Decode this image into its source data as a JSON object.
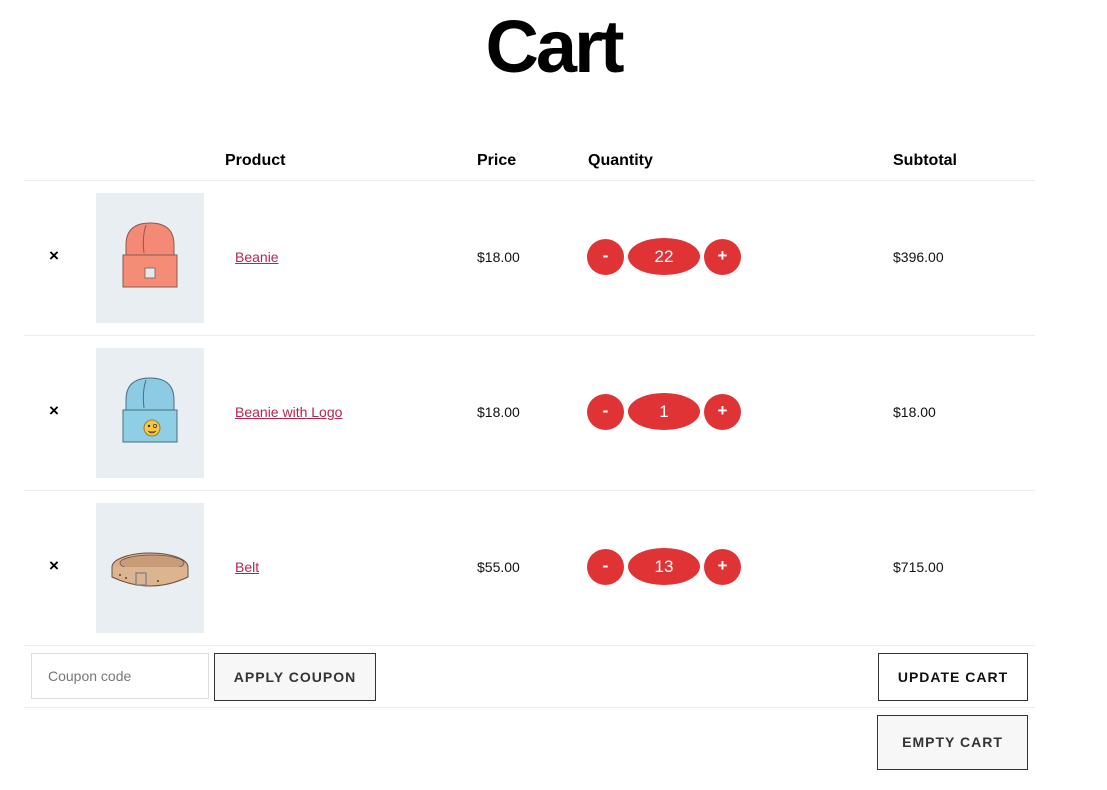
{
  "page": {
    "title": "Cart"
  },
  "table": {
    "headers": {
      "product": "Product",
      "price": "Price",
      "quantity": "Quantity",
      "subtotal": "Subtotal"
    },
    "items": [
      {
        "name": "Beanie",
        "price": "$18.00",
        "quantity": "22",
        "subtotal": "$396.00",
        "image": "orange-beanie",
        "remove": "×",
        "minus": "-",
        "plus": "+"
      },
      {
        "name": "Beanie with Logo",
        "price": "$18.00",
        "quantity": "1",
        "subtotal": "$18.00",
        "image": "blue-beanie-with-emoji-logo",
        "remove": "×",
        "minus": "-",
        "plus": "+"
      },
      {
        "name": "Belt",
        "price": "$55.00",
        "quantity": "13",
        "subtotal": "$715.00",
        "image": "leather-belt",
        "remove": "×",
        "minus": "-",
        "plus": "+"
      }
    ]
  },
  "actions": {
    "coupon_placeholder": "Coupon code",
    "coupon_value": "",
    "apply_coupon": "APPLY COUPON",
    "update_cart": "UPDATE CART",
    "empty_cart": "EMPTY CART"
  },
  "colors": {
    "accent": "#e03336",
    "link": "#b5264f",
    "thumb_bg": "#e8eef2"
  }
}
